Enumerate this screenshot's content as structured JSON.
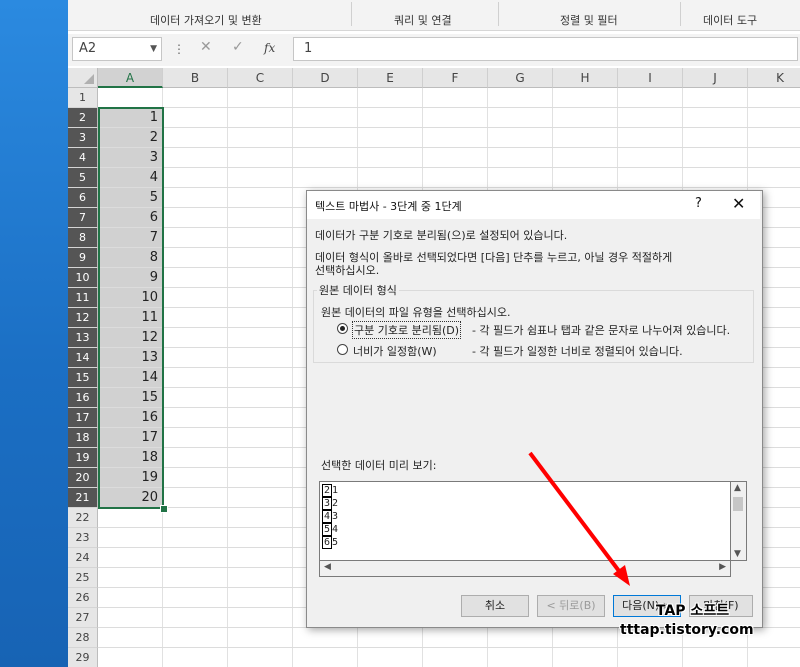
{
  "ribbon": {
    "groups": [
      "데이터 가져오기 및 변환",
      "쿼리 및 연결",
      "정렬 및 필터",
      "데이터 도구"
    ]
  },
  "formula_bar": {
    "name_box": "A2",
    "formula": "1",
    "fx_label": "fx"
  },
  "sheet": {
    "columns": [
      "A",
      "B",
      "C",
      "D",
      "E",
      "F",
      "G",
      "H",
      "I",
      "J",
      "K"
    ],
    "rows": [
      1,
      2,
      3,
      4,
      5,
      6,
      7,
      8,
      9,
      10,
      11,
      12,
      13,
      14,
      15,
      16,
      17,
      18,
      19,
      20,
      21,
      22,
      23,
      24,
      25,
      26,
      27,
      28,
      29
    ],
    "cells_a": [
      "",
      "1",
      "2",
      "3",
      "4",
      "5",
      "6",
      "7",
      "8",
      "9",
      "10",
      "11",
      "12",
      "13",
      "14",
      "15",
      "16",
      "17",
      "18",
      "19",
      "20"
    ],
    "selected_range": "A2:A21"
  },
  "dialog": {
    "title": "텍스트 마법사 - 3단계 중 1단계",
    "help": "?",
    "close": "✕",
    "line1": "데이터가 구분 기호로 분리됨(으)로 설정되어 있습니다.",
    "line2": "데이터 형식이 올바로 선택되었다면 [다음] 단추를 누르고, 아닐 경우 적절하게",
    "line3": "선택하십시오.",
    "group_legend": "원본 데이터 형식",
    "group_prompt": "원본 데이터의 파일 유형을 선택하십시오.",
    "option1_label": "구분 기호로 분리됨(D)",
    "option1_desc": "- 각 필드가 쉼표나 탭과 같은 문자로 나누어져 있습니다.",
    "option2_label": "너비가 일정함(W)",
    "option2_desc": "- 각 필드가 일정한 너비로 정렬되어 있습니다.",
    "selected_option": "option1",
    "preview_label": "선택한 데이터 미리 보기:",
    "preview_rows": [
      {
        "n": "2",
        "v": "1"
      },
      {
        "n": "3",
        "v": "2"
      },
      {
        "n": "4",
        "v": "3"
      },
      {
        "n": "5",
        "v": "4"
      },
      {
        "n": "6",
        "v": "5"
      }
    ],
    "buttons": {
      "cancel": "취소",
      "back": "< 뒤로(B)",
      "next": "다음(N) >",
      "finish": "마침(F)"
    }
  },
  "watermark": {
    "line1": "TAP 소프트",
    "line2": "tttap.tistory.com"
  },
  "colors": {
    "excel_green": "#217346",
    "annotation_arrow": "#ff0000"
  }
}
